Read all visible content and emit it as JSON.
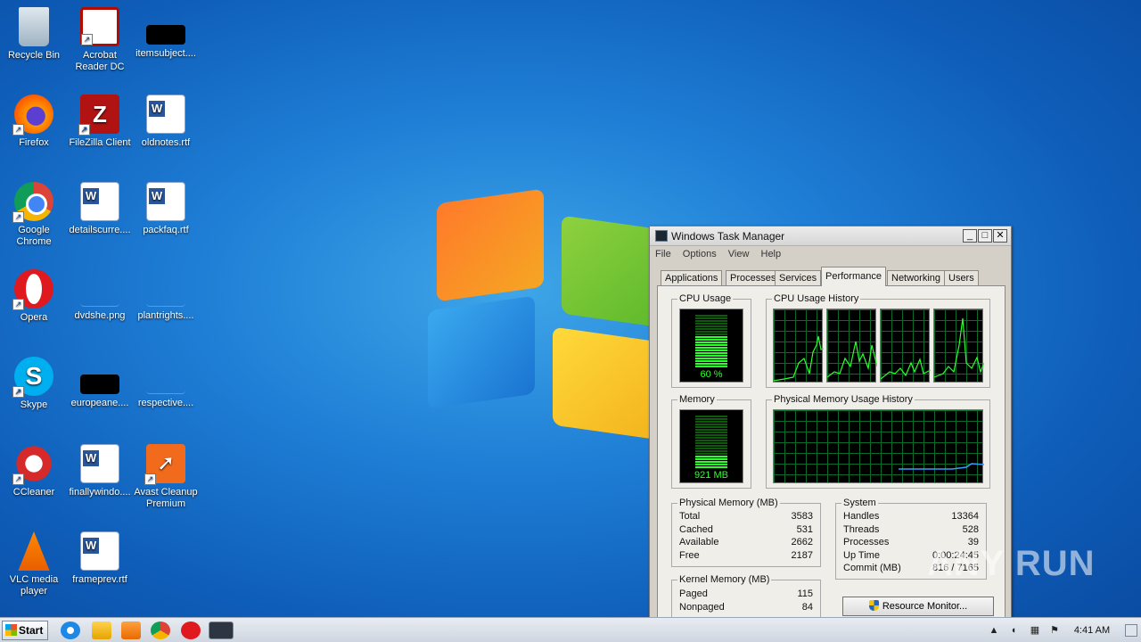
{
  "desktop": {
    "icons": [
      {
        "label": "Recycle Bin"
      },
      {
        "label": "Acrobat Reader DC"
      },
      {
        "label": "itemsubject...."
      },
      {
        "label": "Firefox"
      },
      {
        "label": "FileZilla Client"
      },
      {
        "label": "oldnotes.rtf"
      },
      {
        "label": "Google Chrome"
      },
      {
        "label": "detailscurre...."
      },
      {
        "label": "packfaq.rtf"
      },
      {
        "label": "Opera"
      },
      {
        "label": "dvdshe.png"
      },
      {
        "label": "plantrights...."
      },
      {
        "label": "Skype"
      },
      {
        "label": "europeane...."
      },
      {
        "label": "respective...."
      },
      {
        "label": "CCleaner"
      },
      {
        "label": "finallywindo...."
      },
      {
        "label": "Avast Cleanup Premium"
      },
      {
        "label": "VLC media player"
      },
      {
        "label": "frameprev.rtf"
      }
    ]
  },
  "taskbar": {
    "start_label": "Start",
    "clock": "4:41 AM"
  },
  "task_manager": {
    "title": "Windows Task Manager",
    "menu": [
      "File",
      "Options",
      "View",
      "Help"
    ],
    "tabs": [
      "Applications",
      "Processes",
      "Services",
      "Performance",
      "Networking",
      "Users"
    ],
    "active_tab": "Performance",
    "cpu_usage": {
      "title": "CPU Usage",
      "value_label": "60 %",
      "level": 0.6
    },
    "cpu_history": {
      "title": "CPU Usage History"
    },
    "memory": {
      "title": "Memory",
      "value_label": "921 MB",
      "level": 0.25
    },
    "memory_history": {
      "title": "Physical Memory Usage History"
    },
    "physical_memory": {
      "title": "Physical Memory (MB)",
      "rows": [
        {
          "k": "Total",
          "v": "3583"
        },
        {
          "k": "Cached",
          "v": "531"
        },
        {
          "k": "Available",
          "v": "2662"
        },
        {
          "k": "Free",
          "v": "2187"
        }
      ]
    },
    "system": {
      "title": "System",
      "rows": [
        {
          "k": "Handles",
          "v": "13364"
        },
        {
          "k": "Threads",
          "v": "528"
        },
        {
          "k": "Processes",
          "v": "39"
        },
        {
          "k": "Up Time",
          "v": "0:00:24:45"
        },
        {
          "k": "Commit (MB)",
          "v": "816 / 7165"
        }
      ]
    },
    "kernel_memory": {
      "title": "Kernel Memory (MB)",
      "rows": [
        {
          "k": "Paged",
          "v": "115"
        },
        {
          "k": "Nonpaged",
          "v": "84"
        }
      ]
    },
    "resource_monitor_label": "Resource Monitor..."
  },
  "watermark": "ANY RUN"
}
